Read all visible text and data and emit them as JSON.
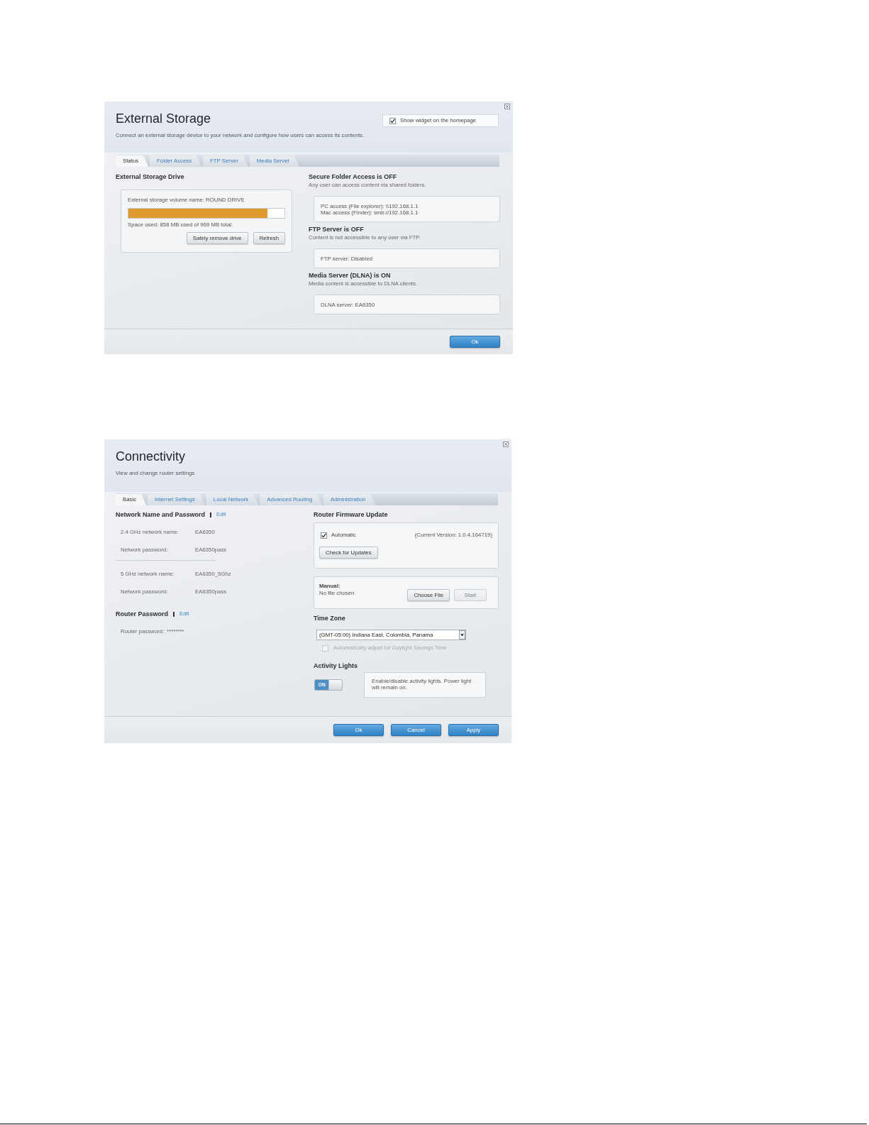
{
  "external_storage": {
    "title": "External Storage",
    "subtitle": "Connect an external storage device to your network and configure how users can access its contents.",
    "show_widget": {
      "label": "Show widget on the homepage",
      "checked": true
    },
    "tabs": [
      {
        "label": "Status",
        "selected": true
      },
      {
        "label": "Folder Access",
        "selected": false
      },
      {
        "label": "FTP Server",
        "selected": false
      },
      {
        "label": "Media Server",
        "selected": false
      }
    ],
    "drive": {
      "heading": "External Storage Drive",
      "volume_name": "External storage volume name: ROUND DRIVE",
      "level": 0.89,
      "space_used": "Space used: 858 MB used of 969 MB total.",
      "buttons": [
        "Safely remove drive",
        "Refresh"
      ]
    },
    "sections": [
      {
        "heading": "Secure Folder Access is OFF",
        "description": "Any user can access content via shared folders.",
        "lines": [
          "PC access (File explorer): \\\\192.168.1.1",
          "Mac access (Finder): smb://192.168.1.1"
        ]
      },
      {
        "heading": "FTP Server is OFF",
        "description": "Content is not accessible to any user via FTP.",
        "lines": [
          "FTP server: Disabled"
        ]
      },
      {
        "heading": "Media Server (DLNA) is ON",
        "description": "Media content is accessible to DLNA clients.",
        "lines": [
          "DLNA server: EA6350"
        ]
      }
    ],
    "footer_buttons": [
      "Ok"
    ]
  },
  "connectivity": {
    "title": "Connectivity",
    "subtitle": "View and change router settings",
    "tabs": [
      {
        "label": "Basic",
        "selected": true
      },
      {
        "label": "Internet Settings",
        "selected": false
      },
      {
        "label": "Local Network",
        "selected": false
      },
      {
        "label": "Advanced Routing",
        "selected": false
      },
      {
        "label": "Administration",
        "selected": false
      }
    ],
    "network": {
      "heading": "Network Name and Password",
      "edit_link": "Edit",
      "groups": [
        {
          "rows": [
            {
              "label": "2.4 GHz network name:",
              "value": "EA6350"
            },
            {
              "label": "Network password:",
              "value": "EA6350pass"
            }
          ]
        },
        {
          "rows": [
            {
              "label": "5 GHz network name:",
              "value": "EA6350_5Ghz"
            },
            {
              "label": "Network password:",
              "value": "EA6350pass"
            }
          ]
        }
      ]
    },
    "router_password": {
      "heading": "Router Password",
      "edit_link": "Edit",
      "label": "Router password:",
      "value": "********"
    },
    "firmware": {
      "heading": "Router Firmware Update",
      "automatic": {
        "label": "Automatic",
        "checked": true
      },
      "current_version": "(Current Version: 1.0.4.164719)",
      "check_button": "Check for Updates",
      "manual_label": "Manual:",
      "file_status": "No file chosen",
      "buttons": [
        {
          "label": "Choose File",
          "disabled": false
        },
        {
          "label": "Start",
          "disabled": true
        }
      ]
    },
    "time_zone": {
      "heading": "Time Zone",
      "value": "(GMT-05:00) Indiana East, Colombia, Panama",
      "daylight": {
        "label": "Automatically adjust for Daylight Savings Time",
        "checked": false,
        "disabled": true
      }
    },
    "activity_lights": {
      "heading": "Activity Lights",
      "on": true,
      "switch_label": "ON",
      "description": "Enable/disable activity lights. Power light will remain on."
    },
    "footer_buttons": [
      "Ok",
      "Cancel",
      "Apply"
    ]
  }
}
